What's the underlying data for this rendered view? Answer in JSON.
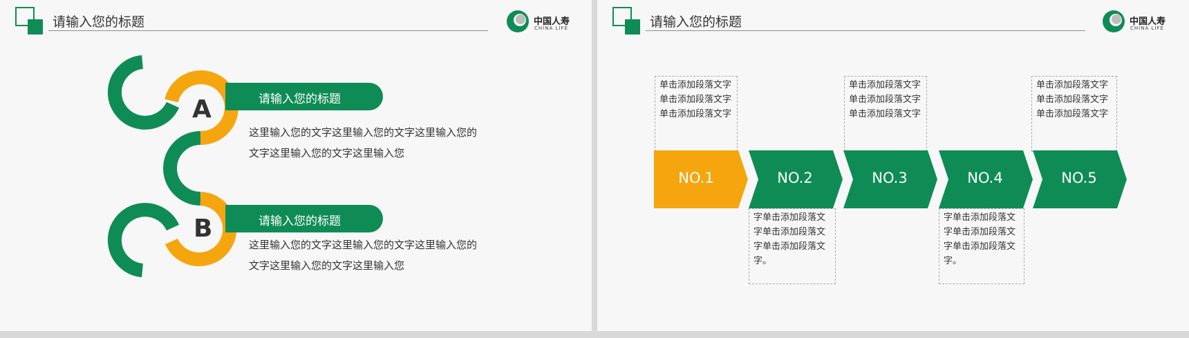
{
  "colors": {
    "green": "#0f8c56",
    "orange": "#f5a60f",
    "text": "#333333"
  },
  "left_slide": {
    "title": "请输入您的标题",
    "brand": {
      "cn": "中国人寿",
      "en": "CHINA LIFE"
    },
    "items": [
      {
        "letter": "A",
        "heading": "请输入您的标题",
        "body": "这里输入您的文字这里输入您的文字这里输入您的文字这里输入您的文字这里输入您"
      },
      {
        "letter": "B",
        "heading": "请输入您的标题",
        "body": "这里输入您的文字这里输入您的文字这里输入您的文字这里输入您的文字这里输入您"
      }
    ]
  },
  "right_slide": {
    "title": "请输入您的标题",
    "brand": {
      "cn": "中国人寿",
      "en": "CHINA LIFE"
    },
    "steps": [
      {
        "label": "NO.1",
        "color": "#f5a60f"
      },
      {
        "label": "NO.2",
        "color": "#0f8c56"
      },
      {
        "label": "NO.3",
        "color": "#0f8c56"
      },
      {
        "label": "NO.4",
        "color": "#0f8c56"
      },
      {
        "label": "NO.5",
        "color": "#0f8c56"
      }
    ],
    "notes_top": [
      "单击添加段落文字单击添加段落文字单击添加段落文字",
      "单击添加段落文字单击添加段落文字单击添加段落文字",
      "单击添加段落文字单击添加段落文字单击添加段落文字"
    ],
    "notes_bottom": [
      "字单击添加段落文字单击添加段落文字单击添加段落文字。",
      "字单击添加段落文字单击添加段落文字单击添加段落文字。"
    ]
  }
}
